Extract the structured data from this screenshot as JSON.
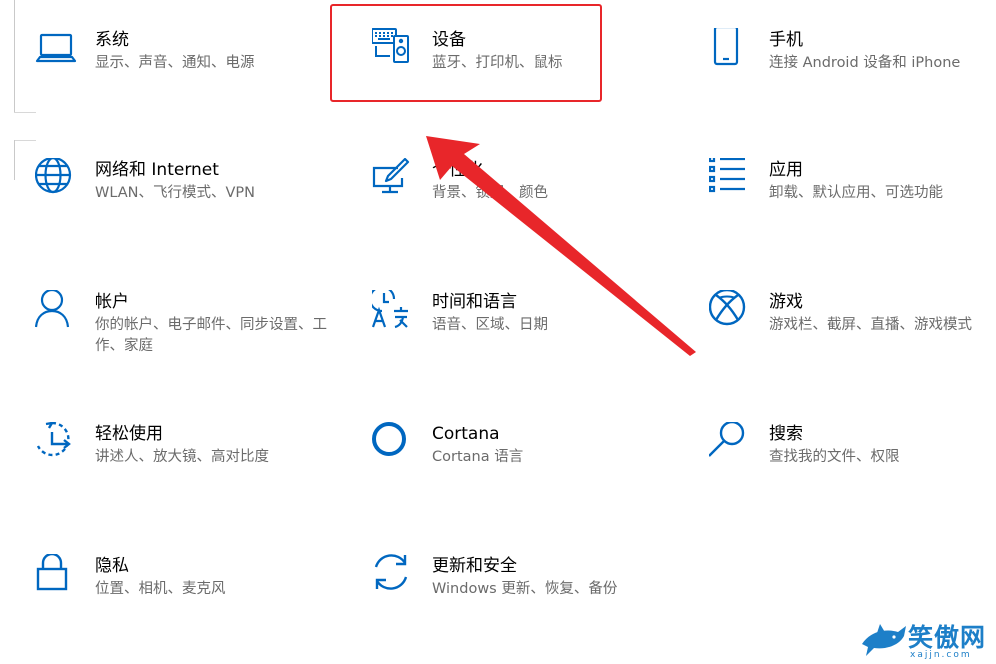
{
  "colors": {
    "accent": "#0067c0",
    "annotation": "#e8262a",
    "description": "#6b6b6b"
  },
  "tiles": [
    {
      "id": "system",
      "icon": "laptop-icon",
      "title": "系统",
      "desc": "显示、声音、通知、电源"
    },
    {
      "id": "devices",
      "icon": "devices-icon",
      "title": "设备",
      "desc": "蓝牙、打印机、鼠标"
    },
    {
      "id": "phone",
      "icon": "phone-icon",
      "title": "手机",
      "desc": "连接 Android 设备和 iPhone"
    },
    {
      "id": "network",
      "icon": "globe-icon",
      "title": "网络和 Internet",
      "desc": "WLAN、飞行模式、VPN"
    },
    {
      "id": "personalization",
      "icon": "paint-brush-icon",
      "title": "个性化",
      "desc": "背景、锁屏、颜色"
    },
    {
      "id": "apps",
      "icon": "app-list-icon",
      "title": "应用",
      "desc": "卸载、默认应用、可选功能"
    },
    {
      "id": "accounts",
      "icon": "person-icon",
      "title": "帐户",
      "desc": "你的帐户、电子邮件、同步设置、工作、家庭"
    },
    {
      "id": "time-language",
      "icon": "time-language-icon",
      "title": "时间和语言",
      "desc": "语音、区域、日期"
    },
    {
      "id": "gaming",
      "icon": "xbox-icon",
      "title": "游戏",
      "desc": "游戏栏、截屏、直播、游戏模式"
    },
    {
      "id": "ease-of-access",
      "icon": "ease-of-access-icon",
      "title": "轻松使用",
      "desc": "讲述人、放大镜、高对比度"
    },
    {
      "id": "cortana",
      "icon": "cortana-ring-icon",
      "title": "Cortana",
      "desc": "Cortana 语言"
    },
    {
      "id": "search",
      "icon": "magnifier-icon",
      "title": "搜索",
      "desc": "查找我的文件、权限"
    },
    {
      "id": "privacy",
      "icon": "lock-icon",
      "title": "隐私",
      "desc": "位置、相机、麦克风"
    },
    {
      "id": "update-security",
      "icon": "sync-arrows-icon",
      "title": "更新和安全",
      "desc": "Windows 更新、恢复、备份"
    }
  ],
  "watermark": {
    "text": "笑傲网",
    "url": "xajjn.com"
  }
}
